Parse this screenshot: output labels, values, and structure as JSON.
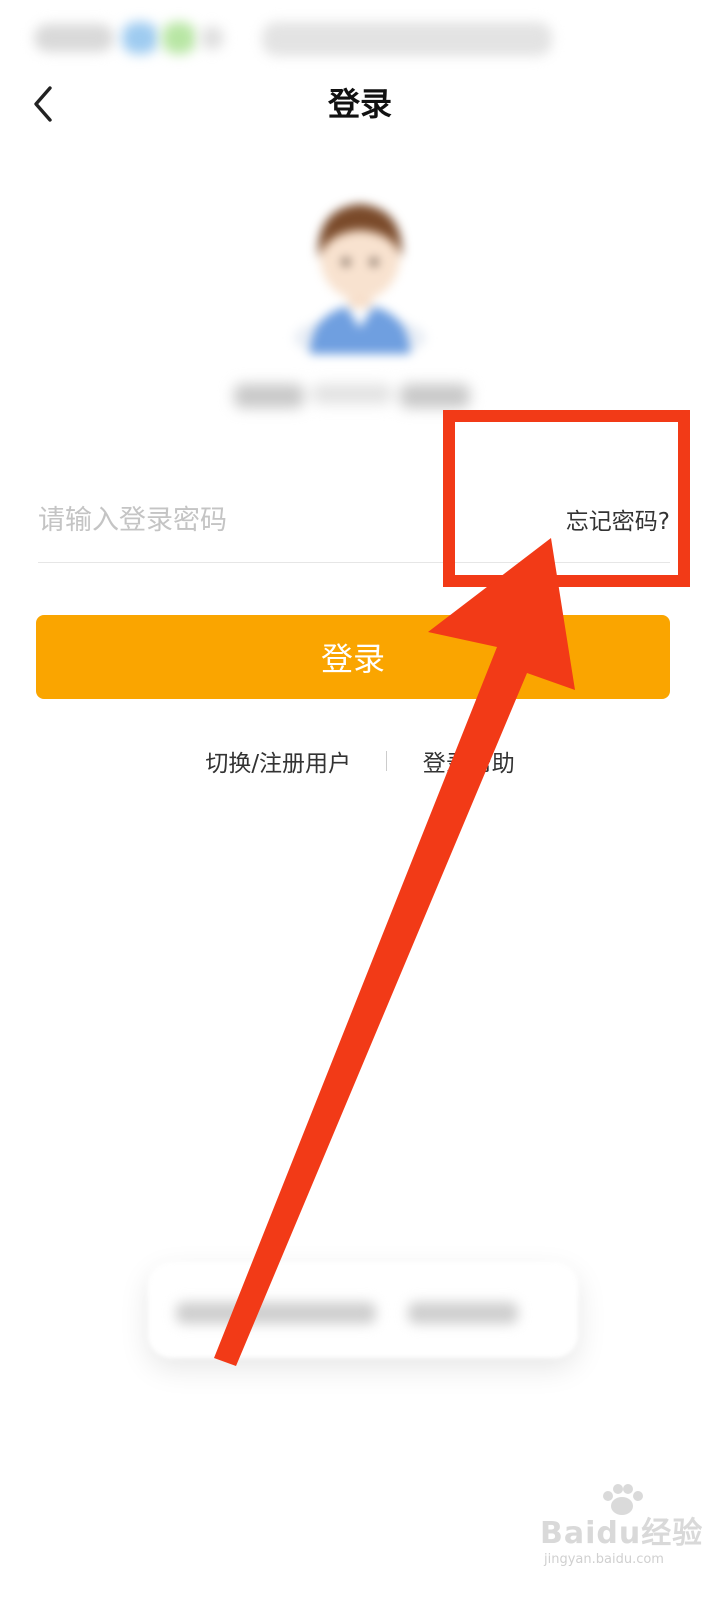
{
  "nav": {
    "title": "登录"
  },
  "login_form": {
    "password_placeholder": "请输入登录密码",
    "password_value": "",
    "forgot_password_label": "忘记密码?",
    "submit_label": "登录"
  },
  "links": {
    "switch_register_label": "切换/注册用户",
    "help_label": "登录帮助"
  },
  "watermark": {
    "brand": "Baidu经验",
    "url": "jingyan.baidu.com"
  },
  "colors": {
    "accent": "#FAA500",
    "annotation": "#F23A17"
  },
  "icons": {
    "back": "chevron-left-icon"
  }
}
